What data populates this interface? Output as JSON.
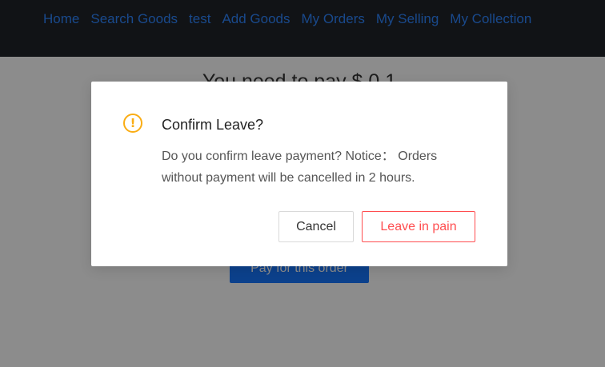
{
  "nav": {
    "items": [
      {
        "label": "Home"
      },
      {
        "label": "Search Goods"
      },
      {
        "label": "test"
      },
      {
        "label": "Add Goods"
      },
      {
        "label": "My Orders"
      },
      {
        "label": "My Selling"
      },
      {
        "label": "My Collection"
      }
    ]
  },
  "page": {
    "pay_title": "You need to pay $ 0.1",
    "pay_button": "Pay for this order"
  },
  "modal": {
    "icon": "exclamation-circle-icon",
    "title": "Confirm Leave?",
    "content": "Do you confirm leave payment? Notice： Orders without payment will be cancelled in 2 hours.",
    "cancel_label": "Cancel",
    "leave_label": "Leave in pain"
  },
  "colors": {
    "navbar_bg": "#1f2328",
    "link": "#2f86ff",
    "primary": "#1677ff",
    "warning": "#faad14",
    "danger": "#ff4d4f"
  }
}
